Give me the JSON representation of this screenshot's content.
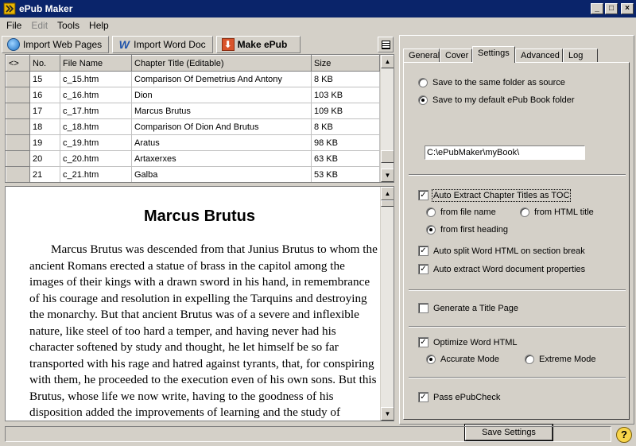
{
  "window": {
    "title": "ePub Maker"
  },
  "menu": [
    "File",
    "Edit",
    "Tools",
    "Help"
  ],
  "toolbar": {
    "import_web": "Import Web Pages",
    "import_word": "Import Word Doc",
    "make_epub": "Make ePub"
  },
  "grid": {
    "headers": [
      "<>",
      "No.",
      "File Name",
      "Chapter Title (Editable)",
      "Size"
    ],
    "rows": [
      {
        "no": "15",
        "file": "c_15.htm",
        "title": "Comparison Of Demetrius And Antony",
        "size": "8 KB"
      },
      {
        "no": "16",
        "file": "c_16.htm",
        "title": "Dion",
        "size": "103 KB"
      },
      {
        "no": "17",
        "file": "c_17.htm",
        "title": "Marcus Brutus",
        "size": "109 KB"
      },
      {
        "no": "18",
        "file": "c_18.htm",
        "title": "Comparison Of Dion And Brutus",
        "size": "8 KB"
      },
      {
        "no": "19",
        "file": "c_19.htm",
        "title": "Aratus",
        "size": "98 KB"
      },
      {
        "no": "20",
        "file": "c_20.htm",
        "title": "Artaxerxes",
        "size": "63 KB"
      },
      {
        "no": "21",
        "file": "c_21.htm",
        "title": "Galba",
        "size": "53 KB"
      }
    ]
  },
  "preview": {
    "heading": "Marcus Brutus",
    "body": "Marcus Brutus was descended from that Junius Brutus to whom the ancient Romans erected a statue of brass in the capitol among the images of their kings with a drawn sword in his hand, in remembrance of his courage and resolution in expelling the Tarquins and destroying the monarchy. But that ancient Brutus was of a severe and inflexible nature, like steel of too hard a temper, and having never had his character softened by study and thought, he let himself be so far transported with his rage and hatred against tyrants, that, for conspiring with them, he proceeded to the execution even of his own sons. But this Brutus, whose life we now write, having to the goodness of his disposition added the improvements of learning and the study of"
  },
  "tabs": [
    "General",
    "Cover",
    "Settings",
    "Advanced",
    "Log"
  ],
  "settings": {
    "save_same": "Save to the same folder as source",
    "save_default": "Save to my default ePub Book folder",
    "folder_path": "C:\\ePubMaker\\myBook\\",
    "auto_extract": "Auto Extract Chapter Titles as TOC",
    "from_file": "from file name",
    "from_html": "from HTML title",
    "from_heading": "from first heading",
    "auto_split": "Auto split Word HTML on section break",
    "auto_props": "Auto extract Word document properties",
    "gen_title": "Generate a Title Page",
    "optimize": "Optimize Word HTML",
    "accurate": "Accurate Mode",
    "extreme": "Extreme Mode",
    "pass_check": "Pass ePubCheck",
    "save_button": "Save Settings"
  }
}
